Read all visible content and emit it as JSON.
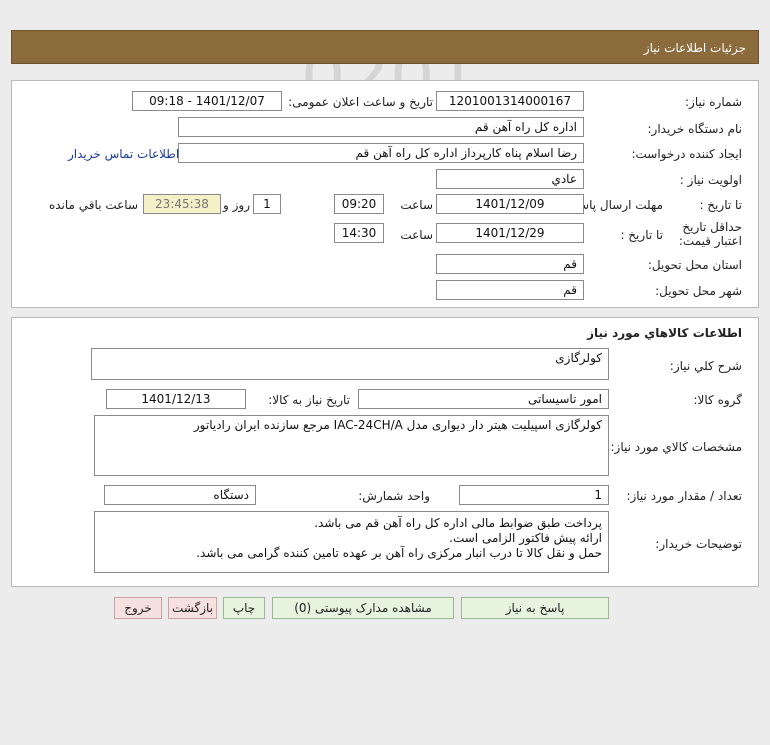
{
  "header": {
    "title": "جزئیات اطلاعات نیاز"
  },
  "info": {
    "need_number_label": "شماره نیاز:",
    "need_number": "1201001314000167",
    "announce_label": "تاریخ و ساعت اعلان عمومی:",
    "announce_value": "1401/12/07 - 09:18",
    "buyer_label": "نام دستگاه خریدار:",
    "buyer_value": "اداره کل  راه آهن قم",
    "creator_label": "ایجاد کننده درخواست:",
    "creator_value": "رضا اسلام پناه کارپرداز اداره کل  راه آهن قم",
    "contact_link": "اطلاعات تماس خریدار",
    "priority_label": "اولویت نیاز :",
    "priority_value": "عادي",
    "deadline_label": "مهلت ارسال پاسخ:",
    "until_date_label": "تا تاریخ :",
    "deadline_date": "1401/12/09",
    "time_label": "ساعت",
    "deadline_time": "09:20",
    "days_value": "1",
    "days_label": "روز و",
    "remaining_time": "23:45:38",
    "remaining_label": "ساعت باقي مانده",
    "validity_label": "حداقل تاریخ اعتبار قیمت:",
    "validity_until_label": "تا تاریخ :",
    "validity_date": "1401/12/29",
    "validity_time_label": "ساعت",
    "validity_time": "14:30",
    "province_label": "استان محل تحویل:",
    "province_value": "قم",
    "city_label": "شهر محل تحویل:",
    "city_value": "قم"
  },
  "goods": {
    "section_title": "اطلاعات کالاهاي مورد نياز",
    "desc_label": "شرح کلي نياز:",
    "desc_value": "کولرگازی",
    "group_label": "گروه کالا:",
    "group_value": "امور تاسیساتی",
    "need_date_label": "تاریخ نیاز به کالا:",
    "need_date_value": "1401/12/13",
    "spec_label": "مشخصات کالاي مورد نياز:",
    "spec_value": "کولرگازی اسپیلیت هیتر دار دیواری مدل IAC-24CH/A مرجع سازنده ایران رادیاتور",
    "qty_label": "تعداد / مقدار مورد نیاز:",
    "qty_value": "1",
    "unit_label": "واحد شمارش:",
    "unit_value": "دستگاه",
    "notes_label": "توضیحات خریدار:",
    "notes_lines": [
      "پرداخت طبق ضوابط مالی اداره کل راه آهن قم می باشد.",
      "ارائه پیش فاکتور الزامی است.",
      "حمل و نقل کالا تا درب انبار مرکزی راه آهن بر عهده تامین کننده گرامی می باشد."
    ]
  },
  "buttons": {
    "respond": "پاسخ به نیاز",
    "attachments": "مشاهده مدارک پیوستی (0)",
    "print": "چاپ",
    "back": "بازگشت",
    "exit": "خروج"
  }
}
